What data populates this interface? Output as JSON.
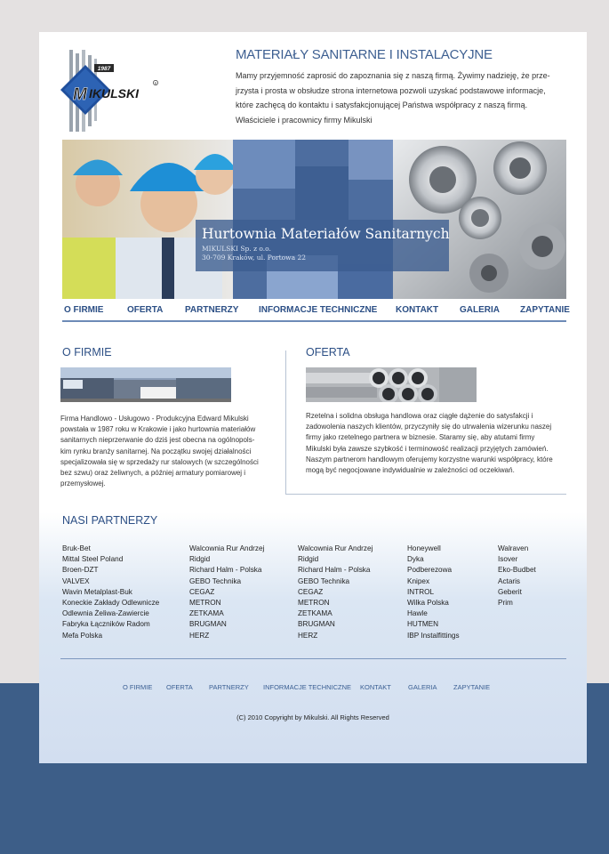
{
  "brand": {
    "logo_text": "MIKULSKI",
    "logo_year": "1987",
    "colors": {
      "primary": "#2c4f85",
      "accent": "#3d5e88",
      "logo_blue": "#1f4f9c"
    }
  },
  "intro": {
    "title": "MATERIAŁY SANITARNE I INSTALACYJNE",
    "lines": [
      "Mamy przyjemność zaprosić do zapoznania się z naszą firmą. Żywimy nadzieję, że prze-",
      "jrzysta i prosta w obsłudze strona internetowa pozwoli uzyskać podstawowe informacje,",
      "które zachęcą do kontaktu i satysfakcjonującej Państwa współpracy z naszą firmą.",
      "Właściciele i pracownicy firmy Mikulski"
    ]
  },
  "banner": {
    "title": "Hurtownia Materiałów Sanitarnych",
    "company": "MIKULSKI Sp. z o.o.",
    "address": "30-709 Kraków, ul. Portowa 22"
  },
  "nav": [
    "O FIRMIE",
    "OFERTA",
    "PARTNERZY",
    "INFORMACJE TECHNICZNE",
    "KONTAKT",
    "GALERIA",
    "ZAPYTANIE"
  ],
  "about": {
    "title": "O FIRMIE",
    "lines": [
      "Firma Handlowo - Usługowo - Produkcyjna Edward Mikulski",
      "powstała w 1987 roku w Krakowie i jako hurtownia materiałów",
      "sanitarnych nieprzerwanie do dziś jest obecna na ogólnopols-",
      "kim rynku branży sanitarnej. Na początku swojej działalności",
      "specjalizowała się w sprzedaży rur stalowych (w szczególności",
      "bez szwu) oraz żeliwnych, a później armatury pomiarowej i",
      "przemysłowej."
    ]
  },
  "offer": {
    "title": "OFERTA",
    "lines": [
      "Rzetelna i solidna obsługa handlowa oraz ciągłe dążenie do satysfakcji i",
      "zadowolenia naszych klientów, przyczyniły się do utrwalenia wizerunku naszej",
      "firmy jako rzetelnego partnera w biznesie. Staramy się, aby atutami firmy",
      "Mikulski była zawsze szybkość i terminowość realizacji przyjętych zamówień.",
      "Naszym partnerom handlowym oferujemy korzystne warunki współpracy, które",
      "mogą być negocjowane indywidualnie w zależności od oczekiwań."
    ]
  },
  "partners": {
    "title": "NASI PARTNERZY",
    "columns": [
      [
        "Bruk-Bet",
        "Mittal Steel Poland",
        "Broen-DZT",
        "VALVEX",
        "Wavin Metalplast-Buk",
        "Koneckie Zakłady Odlewnicze",
        "Odlewnia Żeliwa-Zawiercie",
        "Fabryka Łączników Radom",
        "Mefa Polska"
      ],
      [
        "Walcownia Rur Andrzej",
        "Ridgid",
        "Richard Halm - Polska",
        "GEBO Technika",
        "CEGAZ",
        "METRON",
        "ZETKAMA",
        "BRUGMAN",
        "HERZ"
      ],
      [
        "Walcownia Rur Andrzej",
        "Ridgid",
        "Richard Halm - Polska",
        "GEBO Technika",
        "CEGAZ",
        "METRON",
        "ZETKAMA",
        "BRUGMAN",
        "HERZ"
      ],
      [
        "Honeywell",
        "Dyka",
        "Podberezowa",
        "Knipex",
        "INTROL",
        "Wilka Polska",
        "Hawle",
        "HUTMEN",
        "IBP Instalfittings"
      ],
      [
        "Walraven",
        "Isover",
        "Eko-Budbet",
        "Actaris",
        "Geberit",
        "Prim"
      ]
    ]
  },
  "footer": {
    "nav": [
      "O FIRMIE",
      "OFERTA",
      "PARTNERZY",
      "INFORMACJE TECHNICZNE",
      "KONTAKT",
      "GALERIA",
      "ZAPYTANIE"
    ],
    "copyright": "(C) 2010 Copyright by Mikulski. All Rights Reserved"
  }
}
